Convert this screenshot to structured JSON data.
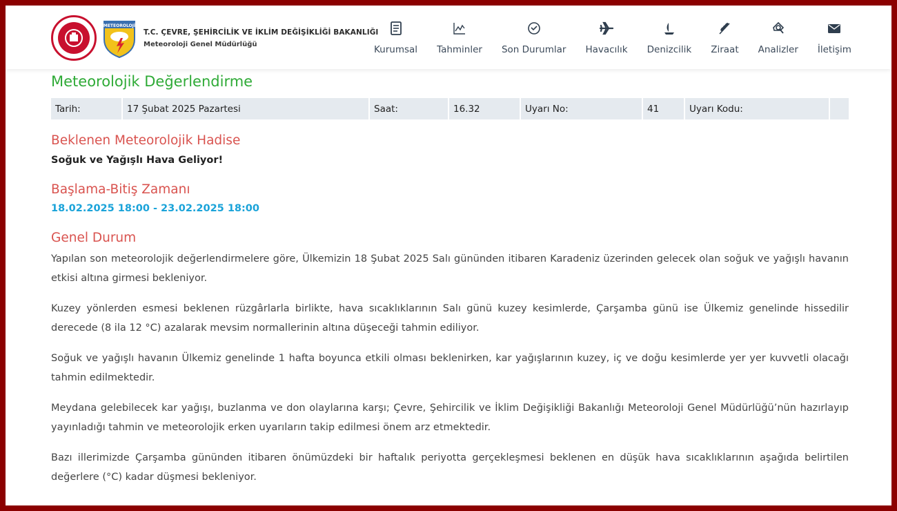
{
  "header": {
    "org_line1": "T.C. ÇEVRE, ŞEHİRCİLİK VE İKLİM DEĞİŞİKLİĞİ BAKANLIĞI",
    "org_line2": "Meteoroloji Genel Müdürlüğü",
    "shield_text": "METEOROLOJİ"
  },
  "nav": [
    {
      "label": "Kurumsal",
      "icon": "document-icon"
    },
    {
      "label": "Tahminler",
      "icon": "chart-icon"
    },
    {
      "label": "Son Durumlar",
      "icon": "check-circle-icon"
    },
    {
      "label": "Havacılık",
      "icon": "airplane-icon"
    },
    {
      "label": "Denizcilik",
      "icon": "sailboat-icon"
    },
    {
      "label": "Ziraat",
      "icon": "wheat-icon"
    },
    {
      "label": "Analizler",
      "icon": "analysis-icon"
    },
    {
      "label": "İletişim",
      "icon": "envelope-icon"
    }
  ],
  "page": {
    "title": "Meteorolojik Değerlendirme"
  },
  "info": {
    "date_label": "Tarih:",
    "date_value": "17 Şubat 2025 Pazartesi",
    "time_label": "Saat:",
    "time_value": "16.32",
    "warning_no_label": "Uyarı No:",
    "warning_no_value": "41",
    "warning_code_label": "Uyarı Kodu:",
    "warning_code_value": ""
  },
  "sections": {
    "hazard_title": "Beklenen Meteorolojik Hadise",
    "hazard_text": "Soğuk ve Yağışlı Hava Geliyor!",
    "period_title": "Başlama-Bitiş Zamanı",
    "period_text": "18.02.2025 18:00 - 23.02.2025 18:00",
    "general_title": "Genel Durum",
    "paragraphs": [
      "Yapılan son meteorolojik değerlendirmelere göre, Ülkemizin 18 Şubat 2025 Salı gününden itibaren Karadeniz üzerinden gelecek olan soğuk ve yağışlı havanın etkisi altına girmesi bekleniyor.",
      "Kuzey yönlerden esmesi beklenen rüzgârlarla birlikte, hava sıcaklıklarının Salı günü kuzey kesimlerde, Çarşamba günü ise Ülkemiz genelinde hissedilir derecede (8 ila 12 °C) azalarak mevsim normallerinin altına düşeceği tahmin ediliyor.",
      "Soğuk ve yağışlı havanın Ülkemiz genelinde 1 hafta boyunca etkili olması beklenirken, kar yağışlarının kuzey, iç ve doğu kesimlerde yer yer kuvvetli olacağı tahmin edilmektedir.",
      "Meydana gelebilecek kar yağışı, buzlanma ve don olaylarına karşı; Çevre, Şehircilik ve İklim Değişikliği Bakanlığı Meteoroloji Genel Müdürlüğü’nün hazırlayıp yayınladığı tahmin ve meteorolojik erken uyarıların takip edilmesi önem arz etmektedir.",
      "Bazı illerimizde Çarşamba gününden itibaren önümüzdeki bir haftalık periyotta gerçekleşmesi beklenen en düşük hava sıcaklıklarının aşağıda belirtilen değerlere (°C) kadar düşmesi bekleniyor."
    ]
  },
  "colors": {
    "frame": "#8b0000",
    "title_green": "#2eaa36",
    "section_red": "#d9534f",
    "time_blue": "#1aa3d9",
    "table_bg": "#e5eaef"
  }
}
